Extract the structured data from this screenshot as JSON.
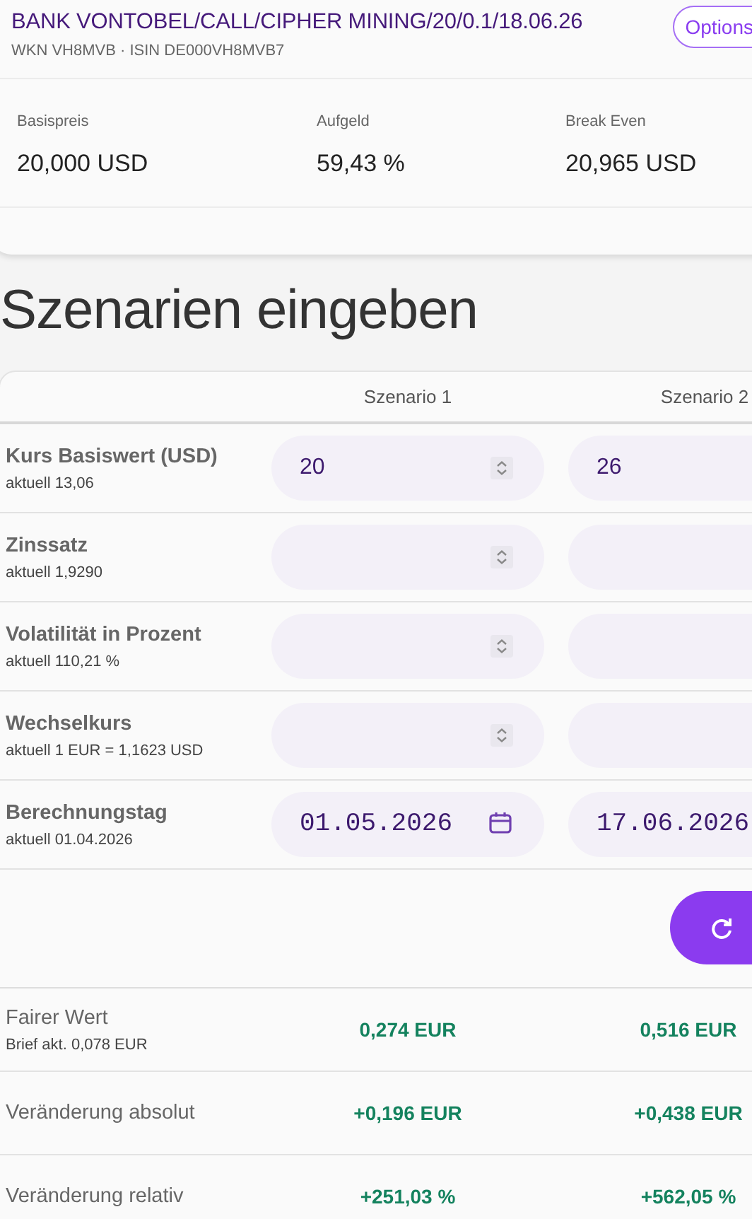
{
  "product": {
    "title": "BANK VONTOBEL/CALL/CIPHER MINING/20/0.1/18.06.26",
    "subtitle": "WKN VH8MVB · ISIN DE000VH8MVB7",
    "options_button": "Options"
  },
  "key_figures": [
    {
      "label": "Basispreis",
      "value": "20,000 USD"
    },
    {
      "label": "Aufgeld",
      "value": "59,43 %"
    },
    {
      "label": "Break Even",
      "value": "20,965 USD"
    }
  ],
  "section_title": "Szenarien eingeben",
  "scenarios": {
    "columns": [
      "Szenario 1",
      "Szenario 2"
    ],
    "inputs": [
      {
        "kind": "number",
        "label": "Kurs Basiswert (USD)",
        "current": "aktuell 13,06",
        "values": [
          "20",
          "26"
        ]
      },
      {
        "kind": "number",
        "label": "Zinssatz",
        "current": "aktuell 1,9290"
      },
      {
        "kind": "number",
        "label": "Volatilität in Prozent",
        "current": "aktuell 110,21 %"
      },
      {
        "kind": "number",
        "label": "Wechselkurs",
        "current": "aktuell 1 EUR = 1,1623 USD"
      },
      {
        "kind": "date",
        "label": "Berechnungstag",
        "current": "aktuell 01.04.2026",
        "values": [
          "01.05.2026",
          "17.06.2026"
        ]
      }
    ]
  },
  "results": [
    {
      "label": "Fairer Wert",
      "sub": "Brief akt. 0,078 EUR",
      "values": [
        "0,274 EUR",
        "0,516 EUR"
      ]
    },
    {
      "label": "Veränderung absolut",
      "values": [
        "+0,196 EUR",
        "+0,438 EUR"
      ]
    },
    {
      "label": "Veränderung relativ",
      "values": [
        "+251,03 %",
        "+562,05 %"
      ]
    }
  ]
}
